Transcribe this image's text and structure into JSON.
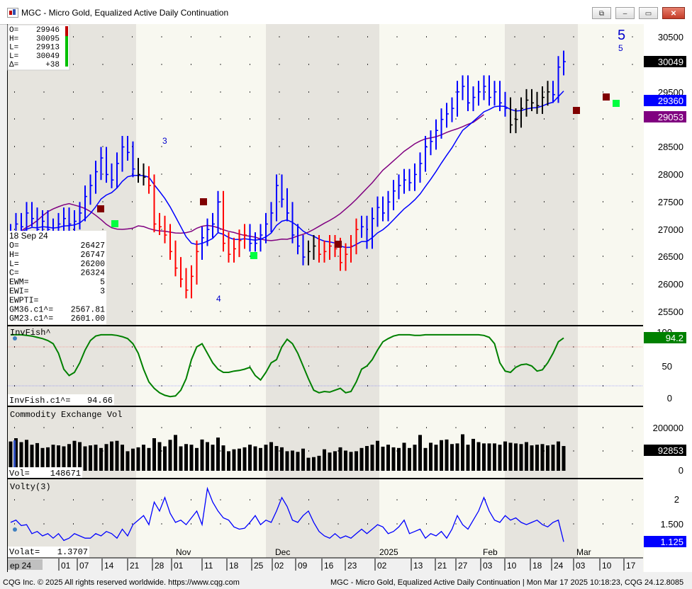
{
  "window": {
    "title": "MGC - Micro Gold, Equalized Active Daily Continuation"
  },
  "titlebar_buttons": {
    "link": "⧉",
    "minimize": "–",
    "restore": "▭",
    "close": "✕"
  },
  "ohlc_box": {
    "rows": [
      {
        "label": "O=",
        "value": "29946"
      },
      {
        "label": "H=",
        "value": "30095"
      },
      {
        "label": "L=",
        "value": "29913"
      },
      {
        "label": "L=",
        "value": "30049"
      },
      {
        "label": "Δ=",
        "value": "+38"
      }
    ]
  },
  "cursor_box": {
    "date": "18 Sep 24",
    "rows": [
      {
        "label": "O=",
        "value": "26427"
      },
      {
        "label": "H=",
        "value": "26747"
      },
      {
        "label": "L=",
        "value": "26200"
      },
      {
        "label": "C=",
        "value": "26324"
      },
      {
        "label": "EWM=",
        "value": "5"
      },
      {
        "label": "EWI=",
        "value": "3"
      },
      {
        "label": "EWPTI=",
        "value": ""
      },
      {
        "label": "GM36.c1^=",
        "value": "2567.81"
      },
      {
        "label": "GM23.c1^=",
        "value": "2601.00"
      }
    ]
  },
  "price_axis": {
    "ticks": [
      "30500",
      "30000",
      "29500",
      "29000",
      "28500",
      "28000",
      "27500",
      "27000",
      "26500",
      "26000",
      "25500"
    ],
    "last_price": "30049",
    "blue_ma": "29360",
    "purple_ma": "29053"
  },
  "wave_labels": {
    "big_5": "5",
    "small_5": "5",
    "wave_3": "3",
    "wave_4": "4"
  },
  "invfish": {
    "title": "InvFish^",
    "readout_label": "InvFish.c1^=",
    "readout_value": "94.66",
    "axis_ticks": [
      "100",
      "50",
      "0"
    ],
    "last_value": "94.2"
  },
  "volume": {
    "title": "Commodity Exchange Vol",
    "readout_label": "Vol=",
    "readout_value": "148671",
    "axis_ticks": [
      "200000",
      "0"
    ],
    "last_value": "92853"
  },
  "volty": {
    "title": "Volty(3)",
    "readout_label": "Volat=",
    "readout_value": "1.3707",
    "axis_ticks": [
      "2",
      "1.500"
    ],
    "last_value": "1.125"
  },
  "month_labels": [
    "Nov",
    "Dec",
    "2025",
    "Feb",
    "Mar"
  ],
  "date_axis": [
    "ep 24",
    "01",
    "07",
    "14",
    "21",
    "28",
    "01",
    "11",
    "18",
    "25",
    "02",
    "09",
    "16",
    "23",
    "02",
    "13",
    "21",
    "27",
    "03",
    "10",
    "18",
    "24",
    "03",
    "10",
    "17"
  ],
  "footer": {
    "left": "CQG Inc. © 2025 All rights reserved worldwide. https://www.cqg.com",
    "right": "MGC - Micro Gold, Equalized Active Daily Continuation | Mon Mar 17 2025 10:18:23, CQG 24.12.8085"
  },
  "colors": {
    "up_bar": "#0000ff",
    "down_bar": "#ff0000",
    "neutral_bar": "#000000",
    "ma_fast": "#0000ff",
    "ma_slow": "#800080",
    "invfish_line": "#008000",
    "volty_line": "#0000ff",
    "alt_band": "#e6e4de",
    "bg": "#f8f8f0"
  }
}
